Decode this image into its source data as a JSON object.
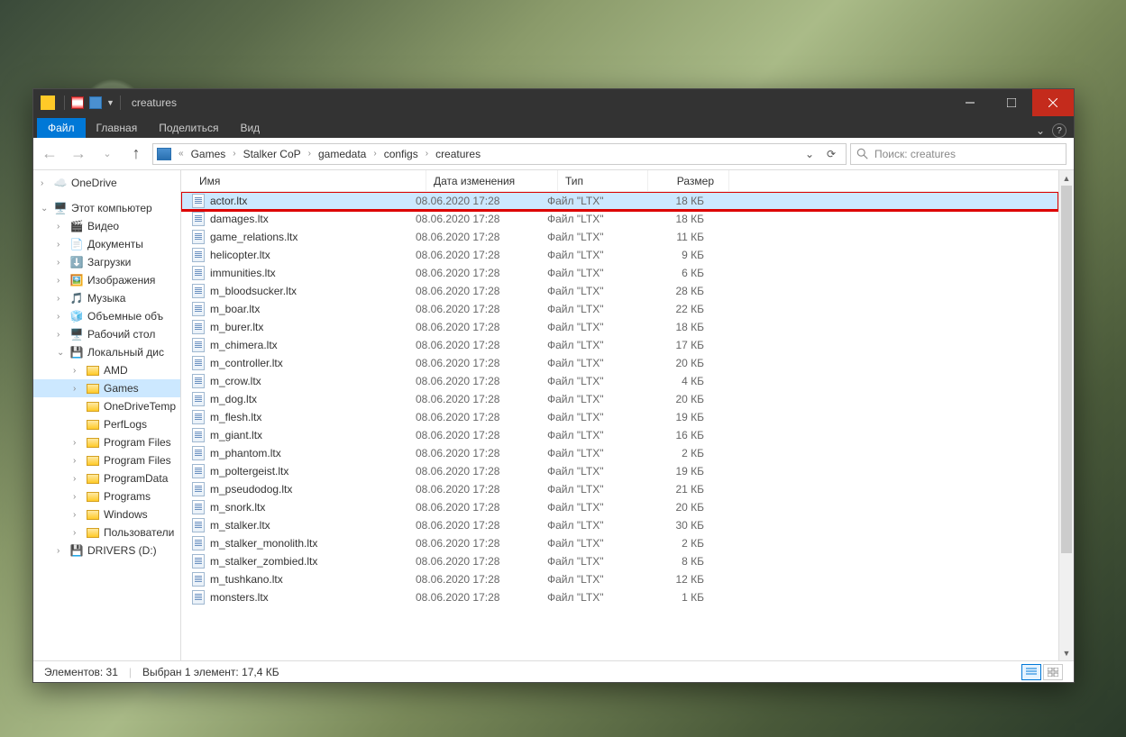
{
  "window": {
    "title": "creatures"
  },
  "tabs": {
    "file": "Файл",
    "home": "Главная",
    "share": "Поделиться",
    "view": "Вид"
  },
  "breadcrumb": [
    "Games",
    "Stalker CoP",
    "gamedata",
    "configs",
    "creatures"
  ],
  "search": {
    "placeholder": "Поиск: creatures"
  },
  "nav": {
    "onedrive": "OneDrive",
    "thispc": "Этот компьютер",
    "video": "Видео",
    "documents": "Документы",
    "downloads": "Загрузки",
    "images": "Изображения",
    "music": "Музыка",
    "objects3d": "Объемные объ",
    "desktop": "Рабочий стол",
    "localdisk": "Локальный дис",
    "amd": "AMD",
    "games": "Games",
    "onedrivetemp": "OneDriveTemp",
    "perflogs": "PerfLogs",
    "programfiles": "Program Files",
    "programfilesx86": "Program Files",
    "programdata": "ProgramData",
    "programs": "Programs",
    "windows": "Windows",
    "users": "Пользователи",
    "drivers": "DRIVERS (D:)"
  },
  "cols": {
    "name": "Имя",
    "date": "Дата изменения",
    "type": "Тип",
    "size": "Размер"
  },
  "files": [
    {
      "n": "actor.ltx",
      "d": "08.06.2020 17:28",
      "t": "Файл \"LTX\"",
      "s": "18 КБ"
    },
    {
      "n": "damages.ltx",
      "d": "08.06.2020 17:28",
      "t": "Файл \"LTX\"",
      "s": "18 КБ"
    },
    {
      "n": "game_relations.ltx",
      "d": "08.06.2020 17:28",
      "t": "Файл \"LTX\"",
      "s": "11 КБ"
    },
    {
      "n": "helicopter.ltx",
      "d": "08.06.2020 17:28",
      "t": "Файл \"LTX\"",
      "s": "9 КБ"
    },
    {
      "n": "immunities.ltx",
      "d": "08.06.2020 17:28",
      "t": "Файл \"LTX\"",
      "s": "6 КБ"
    },
    {
      "n": "m_bloodsucker.ltx",
      "d": "08.06.2020 17:28",
      "t": "Файл \"LTX\"",
      "s": "28 КБ"
    },
    {
      "n": "m_boar.ltx",
      "d": "08.06.2020 17:28",
      "t": "Файл \"LTX\"",
      "s": "22 КБ"
    },
    {
      "n": "m_burer.ltx",
      "d": "08.06.2020 17:28",
      "t": "Файл \"LTX\"",
      "s": "18 КБ"
    },
    {
      "n": "m_chimera.ltx",
      "d": "08.06.2020 17:28",
      "t": "Файл \"LTX\"",
      "s": "17 КБ"
    },
    {
      "n": "m_controller.ltx",
      "d": "08.06.2020 17:28",
      "t": "Файл \"LTX\"",
      "s": "20 КБ"
    },
    {
      "n": "m_crow.ltx",
      "d": "08.06.2020 17:28",
      "t": "Файл \"LTX\"",
      "s": "4 КБ"
    },
    {
      "n": "m_dog.ltx",
      "d": "08.06.2020 17:28",
      "t": "Файл \"LTX\"",
      "s": "20 КБ"
    },
    {
      "n": "m_flesh.ltx",
      "d": "08.06.2020 17:28",
      "t": "Файл \"LTX\"",
      "s": "19 КБ"
    },
    {
      "n": "m_giant.ltx",
      "d": "08.06.2020 17:28",
      "t": "Файл \"LTX\"",
      "s": "16 КБ"
    },
    {
      "n": "m_phantom.ltx",
      "d": "08.06.2020 17:28",
      "t": "Файл \"LTX\"",
      "s": "2 КБ"
    },
    {
      "n": "m_poltergeist.ltx",
      "d": "08.06.2020 17:28",
      "t": "Файл \"LTX\"",
      "s": "19 КБ"
    },
    {
      "n": "m_pseudodog.ltx",
      "d": "08.06.2020 17:28",
      "t": "Файл \"LTX\"",
      "s": "21 КБ"
    },
    {
      "n": "m_snork.ltx",
      "d": "08.06.2020 17:28",
      "t": "Файл \"LTX\"",
      "s": "20 КБ"
    },
    {
      "n": "m_stalker.ltx",
      "d": "08.06.2020 17:28",
      "t": "Файл \"LTX\"",
      "s": "30 КБ"
    },
    {
      "n": "m_stalker_monolith.ltx",
      "d": "08.06.2020 17:28",
      "t": "Файл \"LTX\"",
      "s": "2 КБ"
    },
    {
      "n": "m_stalker_zombied.ltx",
      "d": "08.06.2020 17:28",
      "t": "Файл \"LTX\"",
      "s": "8 КБ"
    },
    {
      "n": "m_tushkano.ltx",
      "d": "08.06.2020 17:28",
      "t": "Файл \"LTX\"",
      "s": "12 КБ"
    },
    {
      "n": "monsters.ltx",
      "d": "08.06.2020 17:28",
      "t": "Файл \"LTX\"",
      "s": "1 КБ"
    }
  ],
  "status": {
    "items": "Элементов: 31",
    "selected": "Выбран 1 элемент: 17,4 КБ"
  }
}
